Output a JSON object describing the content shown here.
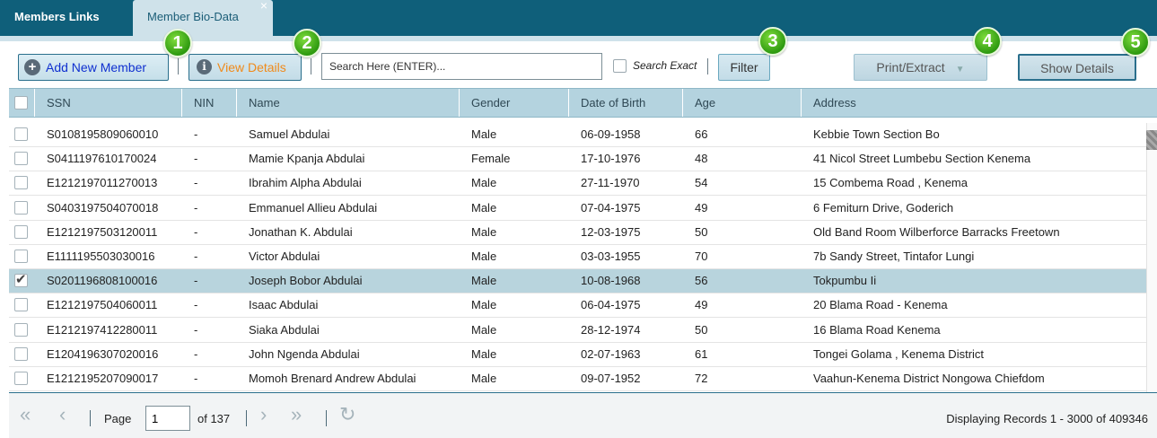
{
  "tabs": [
    {
      "label": "Members Links"
    },
    {
      "label": "Member Bio-Data",
      "close": "×"
    }
  ],
  "toolbar": {
    "add_label": "Add New Member",
    "view_label": "View Details",
    "search_placeholder": "Search Here (ENTER)...",
    "search_exact_label": "Search Exact",
    "filter_label": "Filter",
    "print_label": "Print/Extract",
    "show_label": "Show Details"
  },
  "badges": [
    "1",
    "2",
    "3",
    "4",
    "5"
  ],
  "columns": [
    "SSN",
    "NIN",
    "Name",
    "Gender",
    "Date of Birth",
    "Age",
    "Address"
  ],
  "rows": [
    {
      "ssn": "S0108195809060010",
      "nin": "-",
      "name": "Samuel Abdulai",
      "gender": "Male",
      "dob": "06-09-1958",
      "age": "66",
      "address": "Kebbie Town Section Bo",
      "checked": false
    },
    {
      "ssn": "S0411197610170024",
      "nin": "-",
      "name": "Mamie Kpanja Abdulai",
      "gender": "Female",
      "dob": "17-10-1976",
      "age": "48",
      "address": "41 Nicol Street Lumbebu Section Kenema",
      "checked": false
    },
    {
      "ssn": "E1212197011270013",
      "nin": "-",
      "name": "Ibrahim Alpha Abdulai",
      "gender": "Male",
      "dob": "27-11-1970",
      "age": "54",
      "address": "15 Combema Road , Kenema",
      "checked": false
    },
    {
      "ssn": "S0403197504070018",
      "nin": "-",
      "name": "Emmanuel Allieu Abdulai",
      "gender": "Male",
      "dob": "07-04-1975",
      "age": "49",
      "address": "6 Femiturn Drive, Goderich",
      "checked": false
    },
    {
      "ssn": "E1212197503120011",
      "nin": "-",
      "name": "Jonathan K. Abdulai",
      "gender": "Male",
      "dob": "12-03-1975",
      "age": "50",
      "address": "Old Band Room Wilberforce Barracks Freetown",
      "checked": false
    },
    {
      "ssn": "E1111195503030016",
      "nin": "-",
      "name": "Victor Abdulai",
      "gender": "Male",
      "dob": "03-03-1955",
      "age": "70",
      "address": "7b Sandy Street, Tintafor Lungi",
      "checked": false
    },
    {
      "ssn": "S0201196808100016",
      "nin": "-",
      "name": "Joseph Bobor Abdulai",
      "gender": "Male",
      "dob": "10-08-1968",
      "age": "56",
      "address": "Tokpumbu Ii",
      "checked": true
    },
    {
      "ssn": "E1212197504060011",
      "nin": "-",
      "name": "Isaac Abdulai",
      "gender": "Male",
      "dob": "06-04-1975",
      "age": "49",
      "address": "20 Blama Road - Kenema",
      "checked": false
    },
    {
      "ssn": "E1212197412280011",
      "nin": "-",
      "name": "Siaka Abdulai",
      "gender": "Male",
      "dob": "28-12-1974",
      "age": "50",
      "address": "16 Blama Road Kenema",
      "checked": false
    },
    {
      "ssn": "E1204196307020016",
      "nin": "-",
      "name": "John Ngenda Abdulai",
      "gender": "Male",
      "dob": "02-07-1963",
      "age": "61",
      "address": "Tongei Golama , Kenema District",
      "checked": false
    },
    {
      "ssn": "E1212195207090017",
      "nin": "-",
      "name": "Momoh Brenard Andrew Abdulai",
      "gender": "Male",
      "dob": "09-07-1952",
      "age": "72",
      "address": "Vaahun-Kenema District Nongowa Chiefdom",
      "checked": false
    }
  ],
  "pager": {
    "page_label": "Page",
    "page_value": "1",
    "of_label": "of 137",
    "status": "Displaying Records 1 - 3000 of 409346"
  },
  "colors": {
    "header_bar": "#0f5f7a",
    "grid_header": "#b4d3df",
    "selected_row": "#b8d4dd",
    "add_text": "#1030d0",
    "view_text": "#f08a1a",
    "badge": "#2e9a10"
  },
  "icons": {
    "add": "plus-circle-icon",
    "view": "info-circle-icon",
    "first": "double-chevron-left-icon",
    "prev": "chevron-left-icon",
    "next": "chevron-right-icon",
    "last": "double-chevron-right-icon",
    "refresh": "refresh-icon"
  }
}
